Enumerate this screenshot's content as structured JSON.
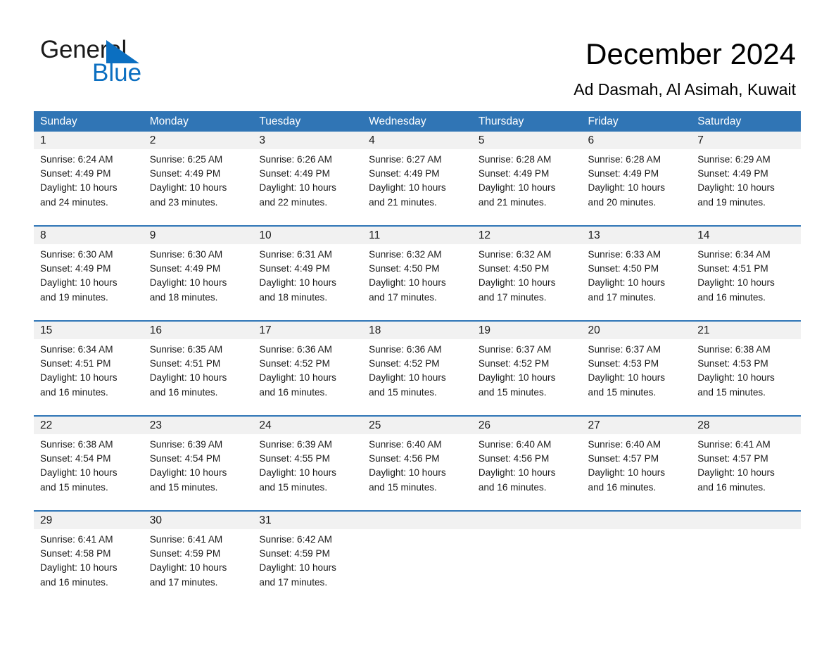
{
  "brand": {
    "name_part1": "General",
    "name_part2": "Blue",
    "triangle_icon": "triangle-icon",
    "accent_color": "#0b6fc1"
  },
  "header": {
    "title": "December 2024",
    "location": "Ad Dasmah, Al Asimah, Kuwait"
  },
  "theme": {
    "header_blue": "#3075B5",
    "row_divider_blue": "#2E75B6",
    "daynum_band": "#F1F1F1"
  },
  "calendar": {
    "weekdays": [
      "Sunday",
      "Monday",
      "Tuesday",
      "Wednesday",
      "Thursday",
      "Friday",
      "Saturday"
    ],
    "weeks": [
      [
        {
          "day": "1",
          "info": "Sunrise: 6:24 AM\nSunset: 4:49 PM\nDaylight: 10 hours\nand 24 minutes."
        },
        {
          "day": "2",
          "info": "Sunrise: 6:25 AM\nSunset: 4:49 PM\nDaylight: 10 hours\nand 23 minutes."
        },
        {
          "day": "3",
          "info": "Sunrise: 6:26 AM\nSunset: 4:49 PM\nDaylight: 10 hours\nand 22 minutes."
        },
        {
          "day": "4",
          "info": "Sunrise: 6:27 AM\nSunset: 4:49 PM\nDaylight: 10 hours\nand 21 minutes."
        },
        {
          "day": "5",
          "info": "Sunrise: 6:28 AM\nSunset: 4:49 PM\nDaylight: 10 hours\nand 21 minutes."
        },
        {
          "day": "6",
          "info": "Sunrise: 6:28 AM\nSunset: 4:49 PM\nDaylight: 10 hours\nand 20 minutes."
        },
        {
          "day": "7",
          "info": "Sunrise: 6:29 AM\nSunset: 4:49 PM\nDaylight: 10 hours\nand 19 minutes."
        }
      ],
      [
        {
          "day": "8",
          "info": "Sunrise: 6:30 AM\nSunset: 4:49 PM\nDaylight: 10 hours\nand 19 minutes."
        },
        {
          "day": "9",
          "info": "Sunrise: 6:30 AM\nSunset: 4:49 PM\nDaylight: 10 hours\nand 18 minutes."
        },
        {
          "day": "10",
          "info": "Sunrise: 6:31 AM\nSunset: 4:49 PM\nDaylight: 10 hours\nand 18 minutes."
        },
        {
          "day": "11",
          "info": "Sunrise: 6:32 AM\nSunset: 4:50 PM\nDaylight: 10 hours\nand 17 minutes."
        },
        {
          "day": "12",
          "info": "Sunrise: 6:32 AM\nSunset: 4:50 PM\nDaylight: 10 hours\nand 17 minutes."
        },
        {
          "day": "13",
          "info": "Sunrise: 6:33 AM\nSunset: 4:50 PM\nDaylight: 10 hours\nand 17 minutes."
        },
        {
          "day": "14",
          "info": "Sunrise: 6:34 AM\nSunset: 4:51 PM\nDaylight: 10 hours\nand 16 minutes."
        }
      ],
      [
        {
          "day": "15",
          "info": "Sunrise: 6:34 AM\nSunset: 4:51 PM\nDaylight: 10 hours\nand 16 minutes."
        },
        {
          "day": "16",
          "info": "Sunrise: 6:35 AM\nSunset: 4:51 PM\nDaylight: 10 hours\nand 16 minutes."
        },
        {
          "day": "17",
          "info": "Sunrise: 6:36 AM\nSunset: 4:52 PM\nDaylight: 10 hours\nand 16 minutes."
        },
        {
          "day": "18",
          "info": "Sunrise: 6:36 AM\nSunset: 4:52 PM\nDaylight: 10 hours\nand 15 minutes."
        },
        {
          "day": "19",
          "info": "Sunrise: 6:37 AM\nSunset: 4:52 PM\nDaylight: 10 hours\nand 15 minutes."
        },
        {
          "day": "20",
          "info": "Sunrise: 6:37 AM\nSunset: 4:53 PM\nDaylight: 10 hours\nand 15 minutes."
        },
        {
          "day": "21",
          "info": "Sunrise: 6:38 AM\nSunset: 4:53 PM\nDaylight: 10 hours\nand 15 minutes."
        }
      ],
      [
        {
          "day": "22",
          "info": "Sunrise: 6:38 AM\nSunset: 4:54 PM\nDaylight: 10 hours\nand 15 minutes."
        },
        {
          "day": "23",
          "info": "Sunrise: 6:39 AM\nSunset: 4:54 PM\nDaylight: 10 hours\nand 15 minutes."
        },
        {
          "day": "24",
          "info": "Sunrise: 6:39 AM\nSunset: 4:55 PM\nDaylight: 10 hours\nand 15 minutes."
        },
        {
          "day": "25",
          "info": "Sunrise: 6:40 AM\nSunset: 4:56 PM\nDaylight: 10 hours\nand 15 minutes."
        },
        {
          "day": "26",
          "info": "Sunrise: 6:40 AM\nSunset: 4:56 PM\nDaylight: 10 hours\nand 16 minutes."
        },
        {
          "day": "27",
          "info": "Sunrise: 6:40 AM\nSunset: 4:57 PM\nDaylight: 10 hours\nand 16 minutes."
        },
        {
          "day": "28",
          "info": "Sunrise: 6:41 AM\nSunset: 4:57 PM\nDaylight: 10 hours\nand 16 minutes."
        }
      ],
      [
        {
          "day": "29",
          "info": "Sunrise: 6:41 AM\nSunset: 4:58 PM\nDaylight: 10 hours\nand 16 minutes."
        },
        {
          "day": "30",
          "info": "Sunrise: 6:41 AM\nSunset: 4:59 PM\nDaylight: 10 hours\nand 17 minutes."
        },
        {
          "day": "31",
          "info": "Sunrise: 6:42 AM\nSunset: 4:59 PM\nDaylight: 10 hours\nand 17 minutes."
        },
        {
          "day": "",
          "info": ""
        },
        {
          "day": "",
          "info": ""
        },
        {
          "day": "",
          "info": ""
        },
        {
          "day": "",
          "info": ""
        }
      ]
    ]
  }
}
